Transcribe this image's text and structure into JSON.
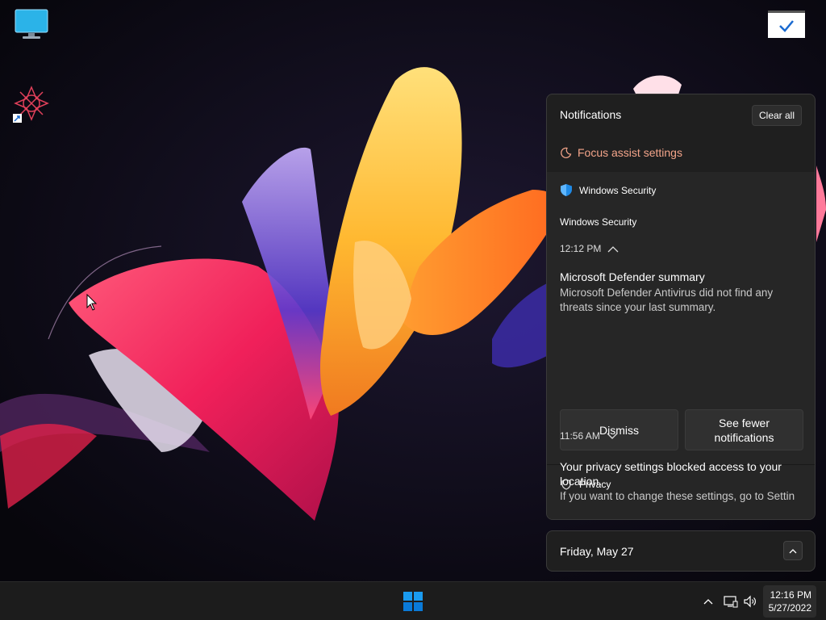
{
  "desktop": {
    "icons": [
      {
        "name": "this-pc-icon"
      },
      {
        "name": "shortcut-app-icon"
      }
    ],
    "widget": {
      "icon": "checkmark-icon"
    }
  },
  "notifications": {
    "title": "Notifications",
    "clear_all": "Clear all",
    "focus_assist": "Focus assist settings",
    "groups": [
      {
        "app": "Windows Security",
        "subheader": "Windows Security",
        "time": "12:12 PM",
        "title": "Microsoft Defender summary",
        "body": "Microsoft Defender Antivirus did not find any threats since your last summary.",
        "actions": [
          "Dismiss",
          "See fewer notifications"
        ]
      },
      {
        "app": "Privacy",
        "time": "11:56 AM",
        "title": "Your privacy settings blocked access to your location.",
        "body": "If you want to change these settings, go to Settin"
      }
    ]
  },
  "calendar": {
    "date": "Friday, May 27"
  },
  "taskbar": {
    "clock_time": "12:16 PM",
    "clock_date": "5/27/2022"
  },
  "colors": {
    "accent": "#f4a58a",
    "start": "#0a8cf0"
  }
}
